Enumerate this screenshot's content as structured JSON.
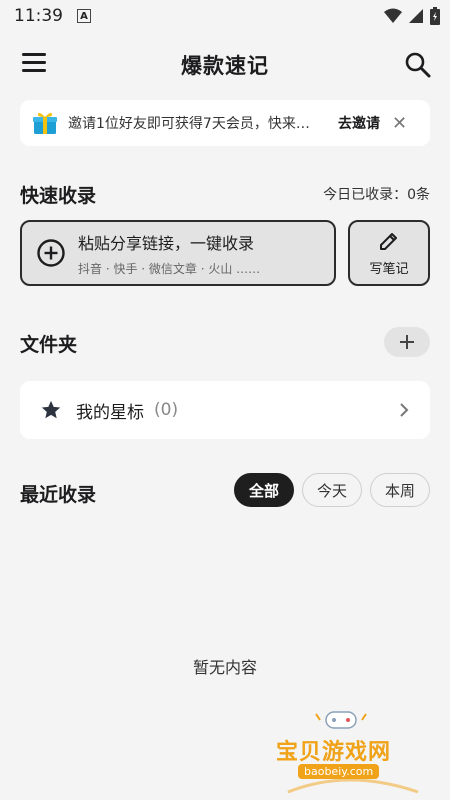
{
  "status_bar": {
    "time": "11:39",
    "a_label": "A"
  },
  "app": {
    "title": "爆款速记"
  },
  "invite": {
    "text": "邀请1位好友即可获得7天会员，快来…",
    "action": "去邀请"
  },
  "quick": {
    "title": "快速收录",
    "today": "今日已收录：0条",
    "paste_main": "粘贴分享链接，一键收录",
    "paste_sub": "抖音 · 快手 · 微信文章 · 火山 ……",
    "write_label": "写笔记"
  },
  "folders": {
    "title": "文件夹",
    "star_label": "我的星标",
    "star_count": "(0)"
  },
  "recent": {
    "title": "最近收录",
    "chips": [
      "全部",
      "今天",
      "本周"
    ],
    "empty": "暂无内容"
  },
  "watermark": {
    "title": "宝贝游戏网",
    "url": "baobeiy.com"
  },
  "colors": {
    "accent_dark": "#1e1e1e",
    "background": "#f4f4f4",
    "watermark": "#f0a319"
  }
}
